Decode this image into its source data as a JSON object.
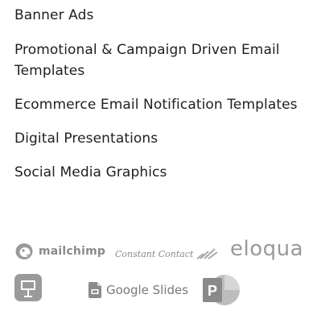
{
  "services": [
    "Banner Ads",
    "Promotional & Campaign Driven Email Templates",
    "Ecommerce Email Notification Templates",
    "Digital Presentations",
    "Social Media Graphics"
  ],
  "logos": {
    "mailchimp": "mailchimp",
    "constant_contact": "Constant Contact",
    "eloqua": "eloqua"
  },
  "apps": {
    "google_slides": "Google Slides",
    "keynote_icon": "keynote-icon",
    "powerpoint_icon": "powerpoint-icon"
  }
}
